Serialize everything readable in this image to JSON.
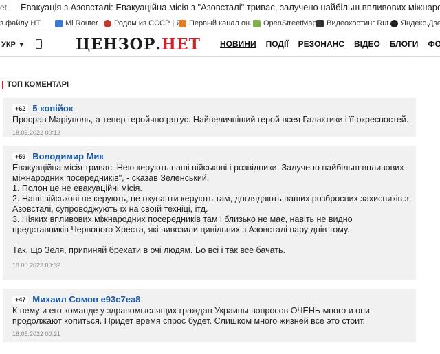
{
  "browser": {
    "prev_tab": "et",
    "active_tab_title": "Евакуація з Азовсталі: Евакуаційна місія з \"Азовсталі\" триває, залучено найбільш впливових міжнародних п"
  },
  "bookmarks": [
    {
      "label": "з файлу НТ",
      "color": "#9e9e9e"
    },
    {
      "label": "Mi Router",
      "color": "#3a7bd5"
    },
    {
      "label": "Родом из СССР | Я",
      "color": "#c0392b"
    },
    {
      "label": "Первый канал он...",
      "color": "#e67e22"
    },
    {
      "label": "OpenStreetMap",
      "color": "#7fb04a"
    },
    {
      "label": "Видеохостинг Rut",
      "color": "#333333"
    },
    {
      "label": "Яндекс.Дзен",
      "color": "#222222"
    }
  ],
  "header": {
    "lang": "УКР",
    "logo_main": "ЦЕНЗОР.",
    "logo_accent": "НЕТ",
    "nav": [
      "НОВИНИ",
      "ПОДІЇ",
      "РЕЗОНАНС",
      "ВІДЕО",
      "БЛОГИ",
      "ФОРУМ"
    ]
  },
  "section": {
    "title": "ТОП КОМЕНТАРІ"
  },
  "comments": [
    {
      "score": "+62",
      "author": "5 копійок",
      "text": "Просрав Маріуполь, а тепер геройчно рятує. Найвеличніший герой всея Галактики і її окресностей.",
      "date": "18.05.2022 00:12"
    },
    {
      "score": "+59",
      "author": "Володимир Мик",
      "text": "Евакуаційна місія триває. Нею керують наші військові і розвідники. Залучено найбільш впливових міжнародних посередників\", - сказав Зеленський.\n1. Полон це не евакуаційні місія.\n2. Наші військові не керують, це окупанти керують там, доглядають наших розброєних захисників з Азовсталі, супроводжують їх на своїй техніці, ітд.\n3. Ніяких впливових міжнародних посередників там і близько не має, навіть не видно представників Червоного Хреста, які вивозили цивільних з Азовсталі пару днів тому.\n\nТак, що Зеля, припиняй брехати в очі людям. Бо всі і так все бачать.",
      "date": "18.05.2022 00:32"
    },
    {
      "score": "+47",
      "author": "Михаил Сомов е93с7еа8",
      "text": "К нему и его команде у здравомыслящих граждан Украины вопросов ОЧЕНЬ много и они продолжают копиться. Придет время спрос будет. Слишком много жизней все это стоит.",
      "date": "18.05.2022 00:21"
    }
  ]
}
